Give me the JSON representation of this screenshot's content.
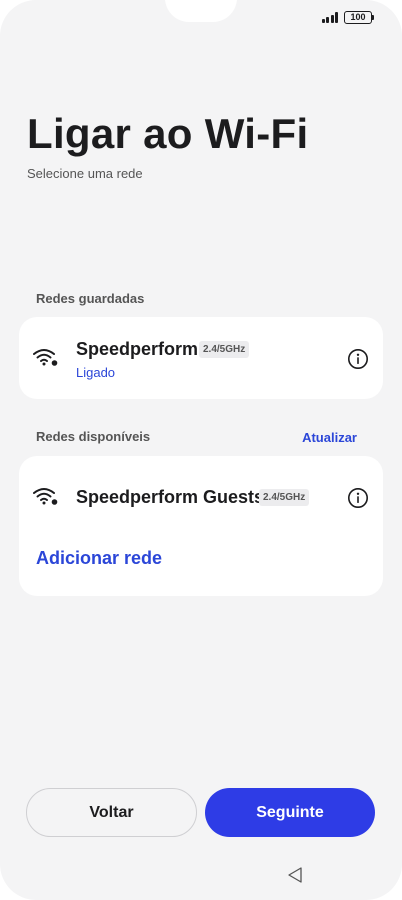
{
  "status_bar": {
    "battery": "100"
  },
  "header": {
    "title": "Ligar ao Wi-Fi",
    "subtitle": "Selecione uma rede"
  },
  "saved": {
    "label": "Redes guardadas",
    "networks": [
      {
        "name": "Speedperform",
        "band": "2.4/5GHz",
        "status": "Ligado",
        "icon": "wifi-icon"
      }
    ]
  },
  "available": {
    "label": "Redes disponíveis",
    "refresh_label": "Atualizar",
    "networks": [
      {
        "name": "Speedperform Guests",
        "band": "2.4/5GHz",
        "icon": "wifi-icon"
      }
    ],
    "add_label": "Adicionar rede"
  },
  "buttons": {
    "back": "Voltar",
    "next": "Seguinte"
  },
  "icons": {
    "info": "info-icon",
    "nav_back": "nav-back-icon"
  },
  "colors": {
    "accent": "#2e3ce6",
    "link": "#2b46d8",
    "background": "#f4f4f5",
    "card": "#ffffff"
  }
}
